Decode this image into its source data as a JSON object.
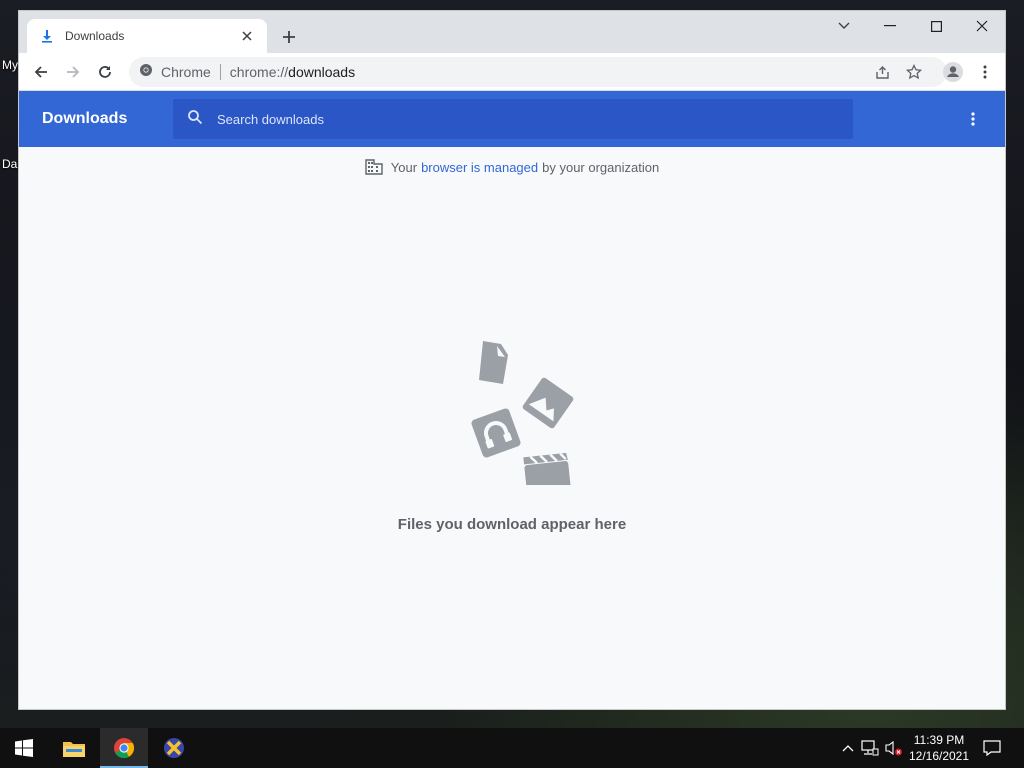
{
  "desktop": {
    "icon_labels": [
      "My",
      "Da"
    ]
  },
  "tab": {
    "title": "Downloads",
    "icon": "download-icon"
  },
  "window_controls": {
    "tab_search": "chevron-down-icon",
    "minimize": "minimize-icon",
    "maximize": "maximize-icon",
    "close": "close-icon"
  },
  "toolbar": {
    "site_label": "Chrome",
    "url_scheme": "chrome://",
    "url_path": "downloads",
    "icons": [
      "back-icon",
      "forward-icon",
      "reload-icon",
      "share-icon",
      "star-icon",
      "profile-icon",
      "menu-icon"
    ]
  },
  "downloads": {
    "title": "Downloads",
    "search_placeholder": "Search downloads",
    "managed_prefix": "Your",
    "managed_link": "browser is managed",
    "managed_suffix": "by your organization",
    "empty_message": "Files you download appear here"
  },
  "taskbar": {
    "apps": [
      "start-icon",
      "file-explorer-icon",
      "chrome-icon",
      "app-icon"
    ],
    "clock_time": "11:39 PM",
    "clock_date": "12/16/2021"
  },
  "colors": {
    "header_blue": "#3367d6",
    "search_blue": "#2a56c6",
    "page_bg": "#f8f9fa",
    "icon_gray": "#9aa0a6"
  }
}
